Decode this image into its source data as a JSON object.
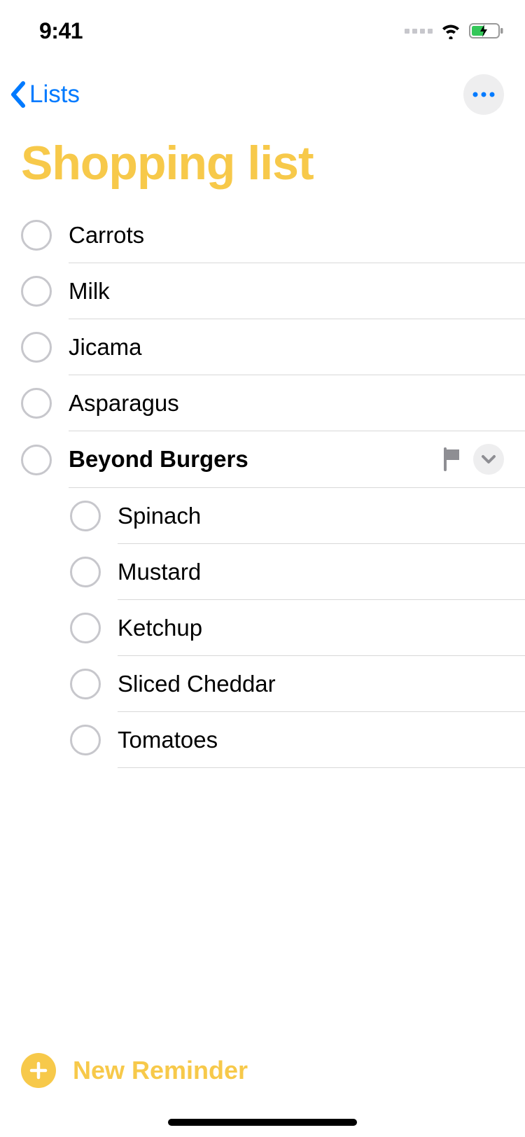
{
  "status": {
    "time": "9:41"
  },
  "nav": {
    "back_label": "Lists"
  },
  "title": "Shopping list",
  "items": [
    {
      "label": "Carrots"
    },
    {
      "label": "Milk"
    },
    {
      "label": "Jicama"
    },
    {
      "label": "Asparagus"
    },
    {
      "label": "Beyond Burgers",
      "flagged": true,
      "expanded": true
    }
  ],
  "subtasks": [
    {
      "label": "Spinach"
    },
    {
      "label": "Mustard"
    },
    {
      "label": "Ketchup"
    },
    {
      "label": "Sliced Cheddar"
    },
    {
      "label": "Tomatoes"
    }
  ],
  "footer": {
    "new_reminder_label": "New Reminder"
  }
}
